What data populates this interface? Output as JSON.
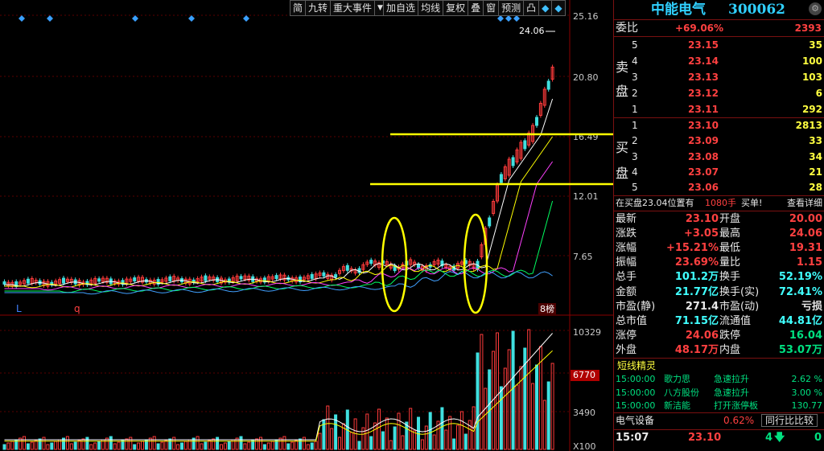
{
  "toolbar": {
    "buttons": [
      "简",
      "九转",
      "重大事件",
      "▼",
      "加自选",
      "均线",
      "复权",
      "叠",
      "窗",
      "预测",
      "凸",
      "◆",
      "◆"
    ]
  },
  "chart": {
    "price_ticks": [
      "25.16",
      "20.80",
      "16.49",
      "12.01",
      "7.65"
    ],
    "volume_ticks": [
      "10329",
      "6770",
      "3490",
      "X100"
    ],
    "high_label": "24.06",
    "marker_l": "L",
    "marker_q": "q",
    "marker_bang": "8榜",
    "colors": {
      "up": "#ff3b3b",
      "down": "#40e0e0",
      "annot": "#ffff00",
      "bg": "#000000"
    }
  },
  "stock": {
    "name": "中能电气",
    "code": "300062"
  },
  "weibi": {
    "label": "委比",
    "pct": "+69.06%",
    "diff": "2393"
  },
  "sell": {
    "label": "卖盘",
    "rows": [
      {
        "lvl": "5",
        "price": "23.15",
        "vol": "35"
      },
      {
        "lvl": "4",
        "price": "23.14",
        "vol": "100"
      },
      {
        "lvl": "3",
        "price": "23.13",
        "vol": "103"
      },
      {
        "lvl": "2",
        "price": "23.12",
        "vol": "6"
      },
      {
        "lvl": "1",
        "price": "23.11",
        "vol": "292"
      }
    ]
  },
  "buy": {
    "label": "买盘",
    "rows": [
      {
        "lvl": "1",
        "price": "23.10",
        "vol": "2813"
      },
      {
        "lvl": "2",
        "price": "23.09",
        "vol": "33"
      },
      {
        "lvl": "3",
        "price": "23.08",
        "vol": "34"
      },
      {
        "lvl": "4",
        "price": "23.07",
        "vol": "21"
      },
      {
        "lvl": "5",
        "price": "23.06",
        "vol": "28"
      }
    ]
  },
  "notice": {
    "prefix": "在买盘23.04位置有",
    "hands": "1080手",
    "action": "买单!",
    "link": "查看详细"
  },
  "quote": [
    {
      "l1": "最新",
      "v1": "23.10",
      "c1": "red",
      "l2": "开盘",
      "v2": "20.00",
      "c2": "red"
    },
    {
      "l1": "涨跌",
      "v1": "+3.05",
      "c1": "red",
      "l2": "最高",
      "v2": "24.06",
      "c2": "red"
    },
    {
      "l1": "涨幅",
      "v1": "+15.21%",
      "c1": "red",
      "l2": "最低",
      "v2": "19.31",
      "c2": "red"
    },
    {
      "l1": "振幅",
      "v1": "23.69%",
      "c1": "red",
      "l2": "量比",
      "v2": "1.15",
      "c2": "red"
    },
    {
      "l1": "总手",
      "v1": "101.2万",
      "c1": "cyn",
      "l2": "换手",
      "v2": "52.19%",
      "c2": "cyn"
    },
    {
      "l1": "金额",
      "v1": "21.77亿",
      "c1": "cyn",
      "l2": "换手(实)",
      "v2": "72.41%",
      "c2": "cyn"
    },
    {
      "l1": "市盈(静)",
      "v1": "271.4",
      "c1": "wht",
      "l2": "市盈(动)",
      "v2": "亏损",
      "c2": "wht"
    },
    {
      "l1": "总市值",
      "v1": "71.15亿",
      "c1": "cyn",
      "l2": "流通值",
      "v2": "44.81亿",
      "c2": "cyn"
    },
    {
      "l1": "涨停",
      "v1": "24.06",
      "c1": "red",
      "l2": "跌停",
      "v2": "16.04",
      "c2": "grn"
    },
    {
      "l1": "外盘",
      "v1": "48.17万",
      "c1": "red",
      "l2": "内盘",
      "v2": "53.07万",
      "c2": "grn"
    }
  ],
  "sprite": {
    "title": "短线精灵",
    "rows": [
      {
        "time": "15:00:00",
        "name": "歌力思",
        "event": "急速拉升",
        "val": "2.62 %"
      },
      {
        "time": "15:00:00",
        "name": "八方股份",
        "event": "急速拉升",
        "val": "3.00 %"
      },
      {
        "time": "15:00:00",
        "name": "新洁能",
        "event": "打开涨停板",
        "val": "130.77"
      }
    ]
  },
  "sector": {
    "name": "电气设备",
    "pct": "0.62%",
    "compare": "同行比比较"
  },
  "footer": {
    "time": "15:07",
    "price": "23.10",
    "count": "4",
    "tail": "0"
  }
}
